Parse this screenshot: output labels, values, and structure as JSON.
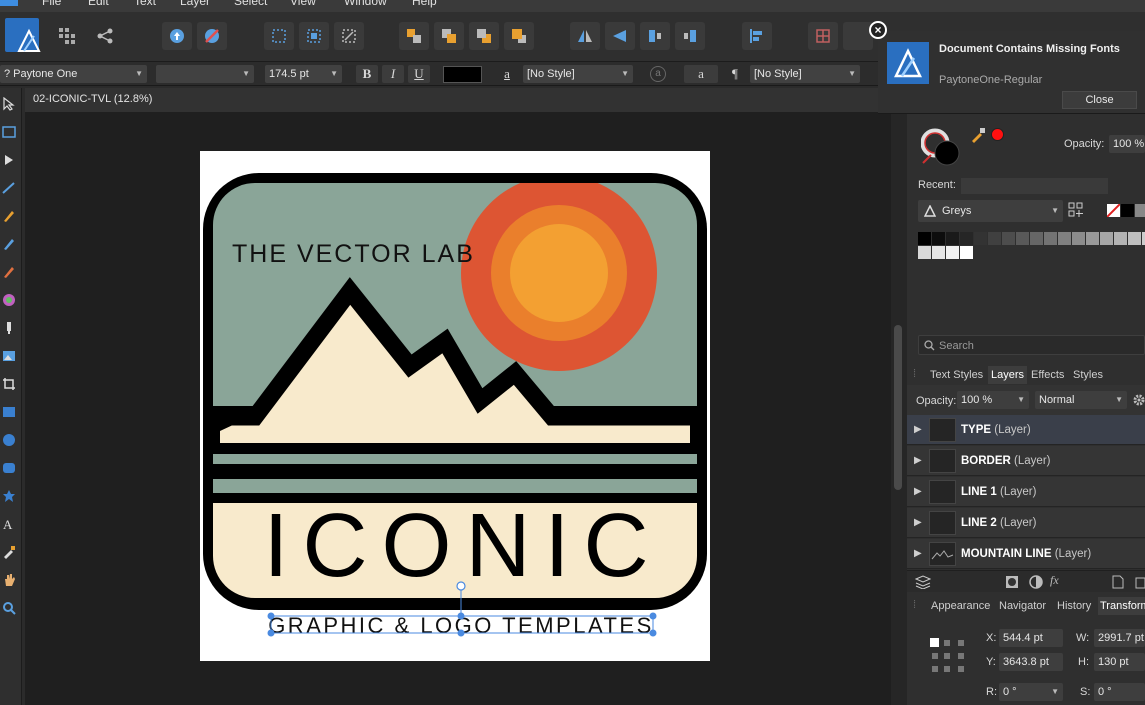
{
  "menu": {
    "items": [
      "File",
      "Edit",
      "Text",
      "Layer",
      "Select",
      "View",
      "Window",
      "Help"
    ]
  },
  "context_bar": {
    "font_family": "? Paytone One",
    "font_style": "",
    "font_size": "174.5 pt",
    "bold": "B",
    "italic": "I",
    "underline": "U",
    "char_style_glyph": "a",
    "char_style": "[No Style]",
    "para_glyph": "¶",
    "para_style": "[No Style]",
    "fill_color": "#000000"
  },
  "document": {
    "tab_label": "02-ICONIC-TVL (12.8%)"
  },
  "artwork": {
    "brand_text": "THE VECTOR LAB",
    "main_text": "ICONIC",
    "sub_text": "GRAPHIC & LOGO TEMPLATES",
    "colors": {
      "sky": "#8aa598",
      "sun_outer": "#dd5533",
      "sun_mid": "#ea7f2c",
      "sun_inner": "#f3a032",
      "cream": "#f8eacc",
      "border": "#000000"
    }
  },
  "notification": {
    "title": "Document Contains Missing Fonts",
    "font": "PaytoneOne-Regular",
    "close_label": "Close"
  },
  "color_panel": {
    "opacity_label": "Opacity:",
    "opacity_value": "100 %",
    "recent_label": "Recent:",
    "palette": "Greys",
    "greys": [
      "#000000",
      "#0d0d0d",
      "#1a1a1a",
      "#262626",
      "#333333",
      "#404040",
      "#4d4d4d",
      "#595959",
      "#666666",
      "#737373",
      "#808080",
      "#8c8c8c",
      "#999999",
      "#a6a6a6",
      "#b3b3b3",
      "#bfbfbf",
      "#cccccc",
      "#d9d9d9",
      "#e6e6e6",
      "#f2f2f2",
      "#ffffff"
    ]
  },
  "search": {
    "placeholder": "Search"
  },
  "layers_panel": {
    "tabs": [
      "Text Styles",
      "Layers",
      "Effects",
      "Styles"
    ],
    "active_tab": "Layers",
    "opacity_label": "Opacity:",
    "opacity_value": "100 %",
    "blend_mode": "Normal",
    "layers": [
      {
        "name": "TYPE",
        "type": "(Layer)"
      },
      {
        "name": "BORDER",
        "type": "(Layer)"
      },
      {
        "name": "LINE 1",
        "type": "(Layer)"
      },
      {
        "name": "LINE 2",
        "type": "(Layer)"
      },
      {
        "name": "MOUNTAIN LINE",
        "type": "(Layer)"
      }
    ]
  },
  "bottom_tabs": {
    "tabs": [
      "Appearance",
      "Navigator",
      "History",
      "Transform"
    ],
    "active": "Transform"
  },
  "transform": {
    "x_label": "X:",
    "x": "544.4 pt",
    "y_label": "Y:",
    "y": "3643.8 pt",
    "w_label": "W:",
    "w": "2991.7 pt",
    "h_label": "H:",
    "h": "130 pt",
    "r_label": "R:",
    "r": "0 °",
    "s_label": "S:",
    "s": "0 °"
  }
}
